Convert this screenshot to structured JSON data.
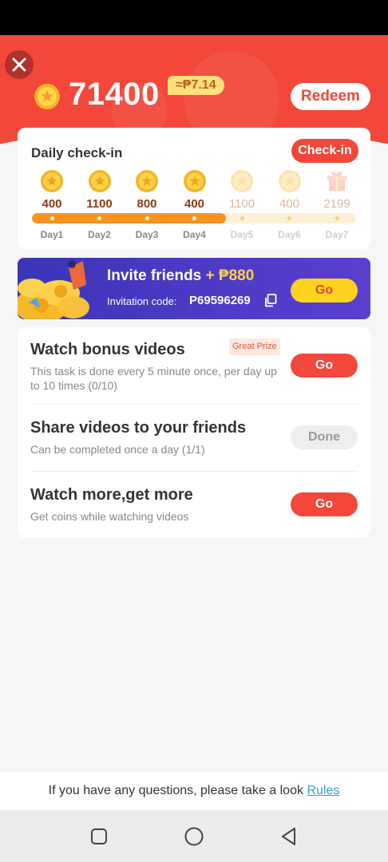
{
  "header": {
    "balance": "71400",
    "balance_value": "≈₱7.14",
    "redeem_label": "Redeem"
  },
  "checkin": {
    "title": "Daily check-in",
    "button_label": "Check-in",
    "days_completed": 4,
    "days": [
      {
        "label": "Day1",
        "amount": "400",
        "reward_icon": "coin-icon",
        "claimed": true
      },
      {
        "label": "Day2",
        "amount": "1100",
        "reward_icon": "coin-icon",
        "claimed": true
      },
      {
        "label": "Day3",
        "amount": "800",
        "reward_icon": "coin-icon",
        "claimed": true
      },
      {
        "label": "Day4",
        "amount": "400",
        "reward_icon": "coin-icon",
        "claimed": true
      },
      {
        "label": "Day5",
        "amount": "1100",
        "reward_icon": "coin-icon",
        "claimed": false
      },
      {
        "label": "Day6",
        "amount": "400",
        "reward_icon": "coin-icon",
        "claimed": false
      },
      {
        "label": "Day7",
        "amount": "2199",
        "reward_icon": "gift-icon",
        "claimed": false
      }
    ]
  },
  "invite": {
    "title": "Invite friends",
    "amount": "+ ₱880",
    "code_label": "Invitation code:",
    "code": "P69596269",
    "go_label": "Go"
  },
  "tasks": [
    {
      "title": "Watch bonus videos",
      "badge": "Great Prize",
      "desc": "This task is done every 5 minute once, per day up to 10 times (0/10)",
      "button": "Go",
      "state": "go"
    },
    {
      "title": "Share videos to your friends",
      "badge": "",
      "desc": "Can be completed once a day (1/1)",
      "button": "Done",
      "state": "done"
    },
    {
      "title": "Watch more,get more",
      "badge": "",
      "desc": "Get coins while watching videos",
      "button": "Go",
      "state": "go"
    }
  ],
  "footer": {
    "text": "If you have any questions, please take a look",
    "link": "Rules"
  },
  "colors": {
    "brand_red": "#f2473a",
    "progress_orange": "#f7931e",
    "invite_purple": "#3b35b8",
    "invite_yellow": "#ffd21e"
  }
}
